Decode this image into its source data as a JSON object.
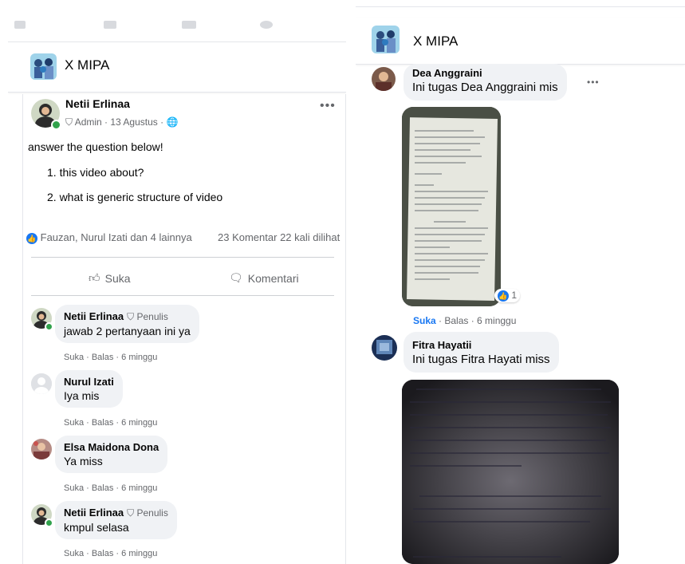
{
  "left": {
    "group": {
      "title": "X MIPA"
    },
    "post": {
      "author": "Netii Erlinaa",
      "role": "Admin",
      "date": "13 Agustus",
      "text": "answer the question below!",
      "items": [
        "1. this video about?",
        "2. what is generic structure of video"
      ],
      "reactions": "Fauzan, Nurul Izati dan 4 lainnya",
      "comments_count": "23 Komentar",
      "views": "22 kali dilihat",
      "like_label": "Suka",
      "comment_label": "Komentari"
    },
    "comments": [
      {
        "name": "Netii Erlinaa",
        "badge": "Penulis",
        "text": "jawab 2 pertanyaan ini ya",
        "actions": "Suka · Balas · 6 minggu"
      },
      {
        "name": "Nurul Izati",
        "badge": "",
        "text": "Iya mis",
        "actions": "Suka · Balas · 6 minggu"
      },
      {
        "name": "Elsa Maidona Dona",
        "badge": "",
        "text": "Ya miss",
        "actions": "Suka · Balas · 6 minggu"
      },
      {
        "name": "Netii Erlinaa",
        "badge": "Penulis",
        "text": "kmpul selasa",
        "actions": "Suka · Balas · 6 minggu"
      }
    ]
  },
  "right": {
    "group": {
      "title": "X MIPA"
    },
    "comments": [
      {
        "name": "Dea Anggraini",
        "text": "Ini tugas Dea Anggraini mis",
        "reaction_count": "1",
        "actions_like": "Suka",
        "actions": " · Balas · 6 minggu"
      },
      {
        "name": "Fitra Hayatii",
        "text": "Ini tugas Fitra Hayati miss"
      }
    ]
  },
  "colors": {
    "accent": "#1877f2",
    "online": "#31a24c",
    "muted": "#65676b",
    "bubble": "#f0f2f5"
  },
  "icons": [
    "shield-icon",
    "globe-icon",
    "more-icon",
    "like-icon",
    "comment-icon",
    "reaction-like-icon"
  ]
}
